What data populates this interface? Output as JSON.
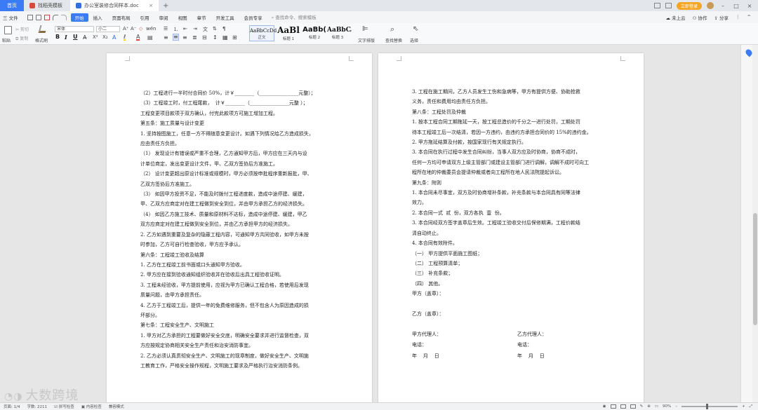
{
  "tabs": {
    "home": "首页",
    "template": "找稻壳模板",
    "document": "办公室装修合同样本.doc",
    "close": "×",
    "new": "+"
  },
  "titlebar": {
    "login": "立即登录"
  },
  "menu": {
    "file": "三 文件",
    "items": [
      "开始",
      "插入",
      "页面布局",
      "引用",
      "审阅",
      "视图",
      "章节",
      "开发工具",
      "会员专享"
    ],
    "search": "查找命令、搜索模板",
    "cloud": "未上云",
    "collab": "协作",
    "share": "分享"
  },
  "ribbon": {
    "paste": "粘贴",
    "cut": "剪切",
    "copy": "复制",
    "format_painter": "格式刷",
    "font_name": "宋体",
    "font_size": "小二",
    "bold": "B",
    "italic": "I",
    "underline": "U",
    "styles": [
      {
        "preview": "AaBbCcDd",
        "label": "正文"
      },
      {
        "preview": "AaBl",
        "label": "标题 1"
      },
      {
        "preview": "AaBb(",
        "label": "标题 2"
      },
      {
        "preview": "AaBbC",
        "label": "标题 3"
      }
    ],
    "text_layout": "文字排版",
    "find_replace": "查找替换",
    "select": "选择"
  },
  "page_left": {
    "lines": [
      "（2）工程进行一半时付合同价 50%，计￥________（________________元整）；",
      "（3）工程竣工时，付工程尾款，  计￥________（________________元整 ）；",
      "工程变更项目款项于双方确认，付完此款项方可施工增加工程。",
      "第五条：施工质量与设计变更",
      "1. 坚持按图施工，任意一方不得随意变更设计。如遇下列情况给乙方造成损失，",
      "应由责任方负担。",
      "（1） 发现设计有错误或严重不合理，乙方通知甲方后，甲方应在三天内与设",
      "计单位商定，发出变更设计文件，甲、乙双方签协后方准施工。",
      "（2） 设计变更超出原设计标准或规模时，甲方必须按申批程序重新报批，甲、",
      "乙双方签协后方准施工。",
      "（3） 如因甲方投资不足，不能及时拨付工程进度款，造成中途停建、缓建，",
      "甲、乙双方应商定对在建工程做到安全到位，并由甲方承担乙方的经济损失。",
      "（4） 如因乙方施工技术、质量和原材料不达标，造成中途停建、缓建，甲乙",
      "双方应商定对在建工程做到安全到位，并由乙方承担甲方的经济损失。",
      "2. 乙方如遇到重要及复杂的隐蔽工程内容，可通知甲方共同验收，如甲方未按",
      "时参加，乙方可自行检查验收，甲方应予承认。",
      "第六条：工程竣工验收及结算",
      "1. 乙方在工程竣工前书面或口头通知甲方验收。",
      "2. 甲方应在接到验收通知组织验收并在验收后出具工程验收证明。",
      "3. 工程未经验收，甲方提前使用，应视为甲方已确认工程合格，若使用后发现",
      "质量问题，由甲方承担责任。",
      "4. 乙方于工程竣工后，提供一年的免费维修服务，但不包含人为原因造成的损",
      "坏部分。",
      "第七条：工程安全生产、文明施工",
      "1. 甲方对乙方承担的工程要做好安全交底，明确安全要求并进行监督检查，双",
      "方应按规定协商相关安全生产责任和治安消防事宜。",
      "2. 乙方必须认真贯彻安全生产、文明施工的现章制度，做好安全生产、文明施",
      "工教育工作，严格安全操作规程，文明施工要求及严格执行治安消防条例。"
    ]
  },
  "page_right": {
    "lines": [
      "3. 工程在施工期间，乙方人员发生工伤和急病等，甲方有提供方便、协助抢救",
      "义务，责任和费用均由责任方负担。",
      "第八条：工程处罚及仲裁",
      "1. 按本工程合同工期拖延一天，按工程总造价的千分之一进行处罚，工期处罚",
      "待本工程竣工后一次结清，若因一方违约，由违约方承担合同价的 15%的违约金。",
      "2. 甲方拖延结算及付款，按国家现行有关规定执行。",
      "3. 本合同在执行过程中发生合同纠纷，当事人双方应及时协商，协商不成时，",
      "任何一方均可申请双方上级主管部门或建设主管部门进行调解，调解不成时可向工",
      "程所在地的仲裁委员会提请仲裁或者向工程所在地人民法院提起诉讼。",
      "第九条：附则",
      "1. 本合同未尽事宜，双方及时协商增补条款，补充条款与本合同具有同等法律",
      "效力。",
      "2. 本合同一式  贰  份，双方各执  壹  份。",
      "3. 本合同经双方签字盖章后生效。工程竣工验收交付后保修期满，工程价款结",
      "清自动终止。",
      "4. 本合同有效附件。",
      "（一） 甲方提供平面施工图纸；",
      "（二） 工程预算清单；",
      "（三） 补充条款；",
      "（四） 其他。",
      "甲方（盖章）：",
      "",
      "乙方（盖章）：",
      ""
    ],
    "signature": [
      {
        "left": "甲方代理人：",
        "right": "乙方代理人："
      },
      {
        "left": "电话：",
        "right": "电话："
      },
      {
        "left": "年    月    日",
        "right": "年    月    日"
      }
    ]
  },
  "status": {
    "page": "页面: 1/4",
    "words": "字数: 2211",
    "spell": "拼写检查",
    "proof": "内容检查",
    "compat": "兼容模式",
    "zoom": "90%",
    "zoom_fraction": 0.45
  },
  "watermark": "大数跨境",
  "colors": {
    "accent": "#3c7bf6",
    "login": "#f5a623"
  }
}
